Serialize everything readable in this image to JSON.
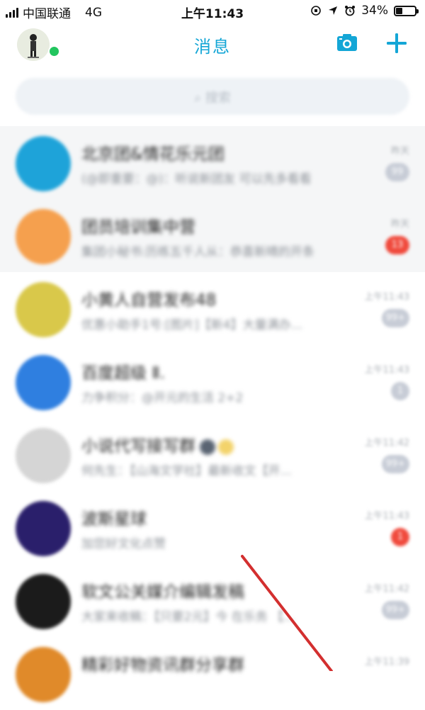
{
  "status_bar": {
    "carrier": "中国联通",
    "network": "4G",
    "time": "上午11:43",
    "battery": "34%",
    "battery_level": 0.34
  },
  "header": {
    "title": "消息",
    "camera_icon": "camera-icon",
    "add_icon": "plus-icon"
  },
  "search": {
    "placeholder": "搜索"
  },
  "conversations": [
    {
      "name": "北京团&情花乐元团",
      "preview": "(@即重要：@)：听说新团友 可以先多看看",
      "time": "昨天",
      "badge": "99",
      "badge_color": "#c7ccd6",
      "pinned": true,
      "avatar_color": "#1ea3d9"
    },
    {
      "name": "团员培训集中营",
      "preview": "集团小秘书:历练五千人从：恭喜新晴的开条",
      "time": "昨天",
      "badge": "13",
      "badge_color": "#f04a3d",
      "pinned": true,
      "avatar_color": "#f5a04e"
    },
    {
      "name": "小黄人自营发布48",
      "preview": "优惠小助手1号:[图片]【新4】大量满办...",
      "time": "上午11:43",
      "badge": "99+",
      "badge_color": "#c7ccd6",
      "pinned": false,
      "avatar_color": "#d9c84a"
    },
    {
      "name": "百度超级 Ⅱ.",
      "preview": "力争积分：@开元的生活 2+2",
      "time": "上午11:43",
      "badge": "1",
      "badge_color": "#c7ccd6",
      "pinned": false,
      "avatar_color": "#2f7fe0"
    },
    {
      "name": "小说代写接写群",
      "preview": "何先生：【山海文学社】最新收文【开...",
      "time": "上午11:42",
      "badge": "99+",
      "badge_color": "#c7ccd6",
      "pinned": false,
      "avatar_color": "#d5d5d5"
    },
    {
      "name": "波斯星球",
      "preview": "加您好文化点赞",
      "time": "上午11:43",
      "badge": "1",
      "badge_color": "#f04a3d",
      "pinned": false,
      "avatar_color": "#2a1f6b"
    },
    {
      "name": "软文公关媒介编辑发稿",
      "preview": "大家来收稿：【只要2元】今 在乐务 【...",
      "time": "上午11:42",
      "badge": "99+",
      "badge_color": "#c7ccd6",
      "pinned": false,
      "avatar_color": "#1b1b1b"
    },
    {
      "name": "精彩好物资讯群分享群",
      "preview": "",
      "time": "上午11:39",
      "badge": "",
      "badge_color": "#c7ccd6",
      "pinned": false,
      "avatar_color": "#e08a2a"
    }
  ],
  "colors": {
    "accent": "#14a6d6",
    "online": "#22c55e",
    "arrow": "#d32f2f"
  }
}
